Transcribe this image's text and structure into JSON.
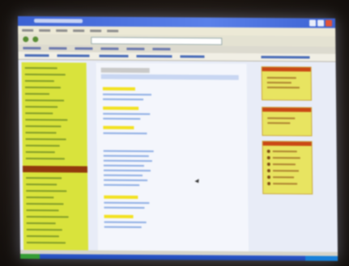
{
  "scene": {
    "description_kind": "photo",
    "subject": "projected-browser-window"
  },
  "colors": {
    "nav_bg": "#d9e24a",
    "nav_highlight": "#8a3a12",
    "widget_bg": "#e7e36c",
    "widget_header": "#c04a1c",
    "titlebar": "#3f62c8",
    "taskbar": "#244aa8"
  },
  "icons": [
    "minimize-icon",
    "maximize-icon",
    "close-icon",
    "back-icon",
    "forward-icon",
    "mouse-pointer-icon",
    "start-button-icon"
  ]
}
